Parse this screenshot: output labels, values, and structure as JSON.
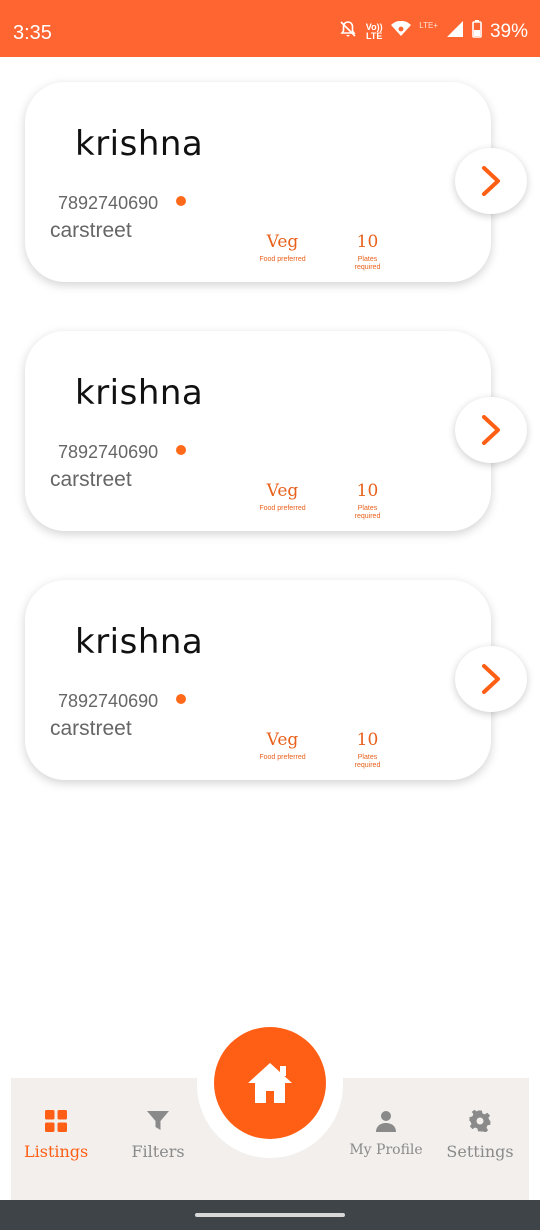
{
  "status_bar": {
    "time": "3:35",
    "volte": "Vo)) LTE",
    "lte_plus": "LTE+",
    "battery": "39%",
    "icons": [
      "mute-icon",
      "wifi-icon",
      "signal-icon",
      "battery-icon"
    ],
    "color": "#ff6530"
  },
  "listings": [
    {
      "name": "krishna",
      "phone": "7892740690",
      "street": "carstreet",
      "food": "Veg",
      "food_label": "Food preferred",
      "plates": "10",
      "plates_label": "Plates required"
    },
    {
      "name": "krishna",
      "phone": "7892740690",
      "street": "carstreet",
      "food": "Veg",
      "food_label": "Food preferred",
      "plates": "10",
      "plates_label": "Plates required"
    },
    {
      "name": "krishna",
      "phone": "7892740690",
      "street": "carstreet",
      "food": "Veg",
      "food_label": "Food preferred",
      "plates": "10",
      "plates_label": "Plates required"
    }
  ],
  "nav": {
    "listings": "Listings",
    "filters": "Filters",
    "profile": "My Profile",
    "settings": "Settings",
    "home_icon": "home-icon"
  },
  "colors": {
    "accent": "#ff5f15",
    "nav_bg": "#f2efed"
  }
}
